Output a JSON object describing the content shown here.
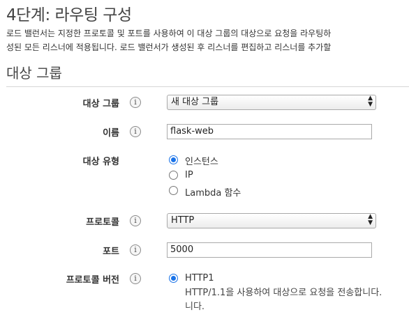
{
  "page": {
    "title": "4단계: 라우팅 구성",
    "description_line1": "로드 밸런서는 지정한 프로토콜 및 포트를 사용하여 이 대상 그룹의 대상으로 요청을 라우팅하",
    "description_line2": "성된 모든 리스너에 적용됩니다. 로드 밸런서가 생성된 후 리스너를 편집하고 리스너를 추가할"
  },
  "section": {
    "title": "대상 그룹"
  },
  "form": {
    "target_group": {
      "label": "대상 그룹",
      "value": "새 대상 그룹"
    },
    "name": {
      "label": "이름",
      "value": "flask-web"
    },
    "target_type": {
      "label": "대상 유형",
      "options": [
        "인스턴스",
        "IP",
        "Lambda 함수"
      ],
      "selected": "인스턴스"
    },
    "protocol": {
      "label": "프로토콜",
      "value": "HTTP"
    },
    "port": {
      "label": "포트",
      "value": "5000"
    },
    "protocol_version": {
      "label": "프로토콜 버전",
      "option": "HTTP1",
      "help_line1": "HTTP/1.1을 사용하여 대상으로 요청을 전송합니다.",
      "help_line2": "니다."
    }
  },
  "icons": {
    "info": "i",
    "select_up": "▲",
    "select_down": "▼"
  }
}
